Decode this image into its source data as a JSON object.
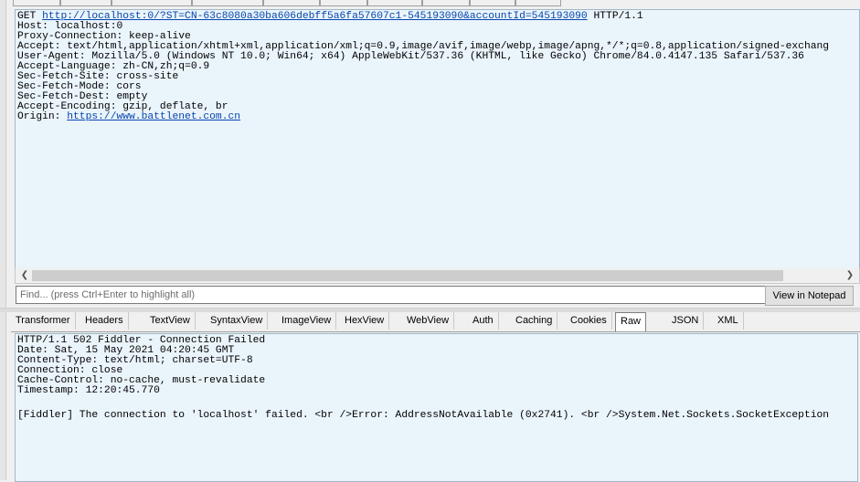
{
  "request": {
    "raw_lines": [
      {
        "pre": "GET ",
        "link": "http://localhost:0/?ST=CN-63c8080a30ba606debff5a6fa57607c1-545193090&accountId=545193090",
        "post": " HTTP/1.1"
      },
      {
        "text": "Host: localhost:0"
      },
      {
        "text": "Proxy-Connection: keep-alive"
      },
      {
        "text": "Accept: text/html,application/xhtml+xml,application/xml;q=0.9,image/avif,image/webp,image/apng,*/*;q=0.8,application/signed-exchang"
      },
      {
        "text": "User-Agent: Mozilla/5.0 (Windows NT 10.0; Win64; x64) AppleWebKit/537.36 (KHTML, like Gecko) Chrome/84.0.4147.135 Safari/537.36"
      },
      {
        "text": "Accept-Language: zh-CN,zh;q=0.9"
      },
      {
        "text": "Sec-Fetch-Site: cross-site"
      },
      {
        "text": "Sec-Fetch-Mode: cors"
      },
      {
        "text": "Sec-Fetch-Dest: empty"
      },
      {
        "text": "Accept-Encoding: gzip, deflate, br"
      },
      {
        "pre": "Origin: ",
        "link": "https://www.battlenet.com.cn",
        "post": ""
      }
    ],
    "find_placeholder": "Find... (press Ctrl+Enter to highlight all)",
    "view_in_notepad": "View in Notepad"
  },
  "response": {
    "tabs": [
      {
        "label": "Transformer"
      },
      {
        "label": "Headers"
      },
      {
        "label": "TextView"
      },
      {
        "label": "SyntaxView"
      },
      {
        "label": "ImageView"
      },
      {
        "label": "HexView"
      },
      {
        "label": "WebView"
      },
      {
        "label": "Auth"
      },
      {
        "label": "Caching"
      },
      {
        "label": "Cookies"
      },
      {
        "label": "Raw",
        "active": true
      },
      {
        "label": "JSON"
      },
      {
        "label": "XML"
      }
    ],
    "raw_lines": [
      "HTTP/1.1 502 Fiddler - Connection Failed",
      "Date: Sat, 15 May 2021 04:20:45 GMT",
      "Content-Type: text/html; charset=UTF-8",
      "Connection: close",
      "Cache-Control: no-cache, must-revalidate",
      "Timestamp: 12:20:45.770",
      "",
      "[Fiddler] The connection to 'localhost' failed. <br />Error: AddressNotAvailable (0x2741). <br />System.Net.Sockets.SocketException"
    ]
  },
  "colors": {
    "text_bg": "#eaf4fb",
    "link": "#0645ad"
  }
}
